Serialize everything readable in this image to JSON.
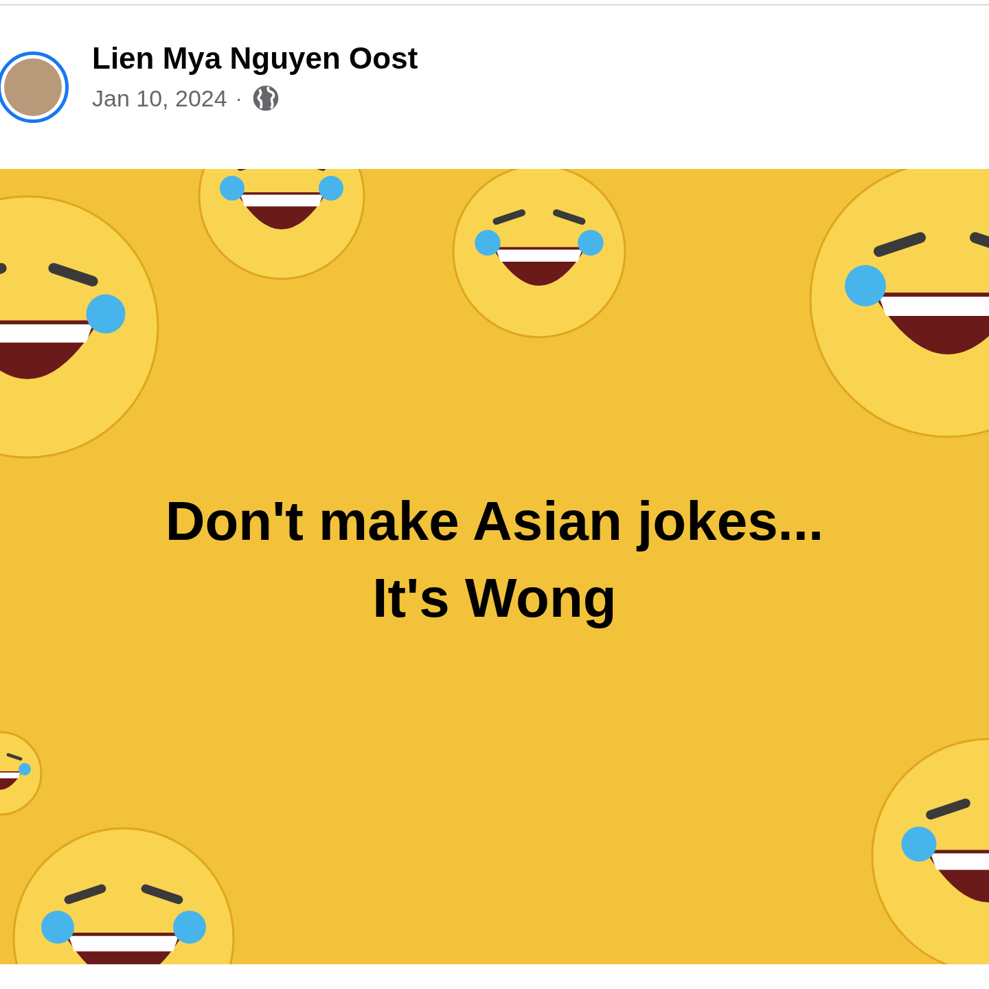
{
  "post": {
    "author": {
      "name": "Lien Mya Nguyen Oost",
      "has_story": true
    },
    "date": "Jan 10, 2024",
    "separator": "·",
    "text_lines": [
      "Don't make Asian jokes...",
      "It's Wong"
    ]
  }
}
